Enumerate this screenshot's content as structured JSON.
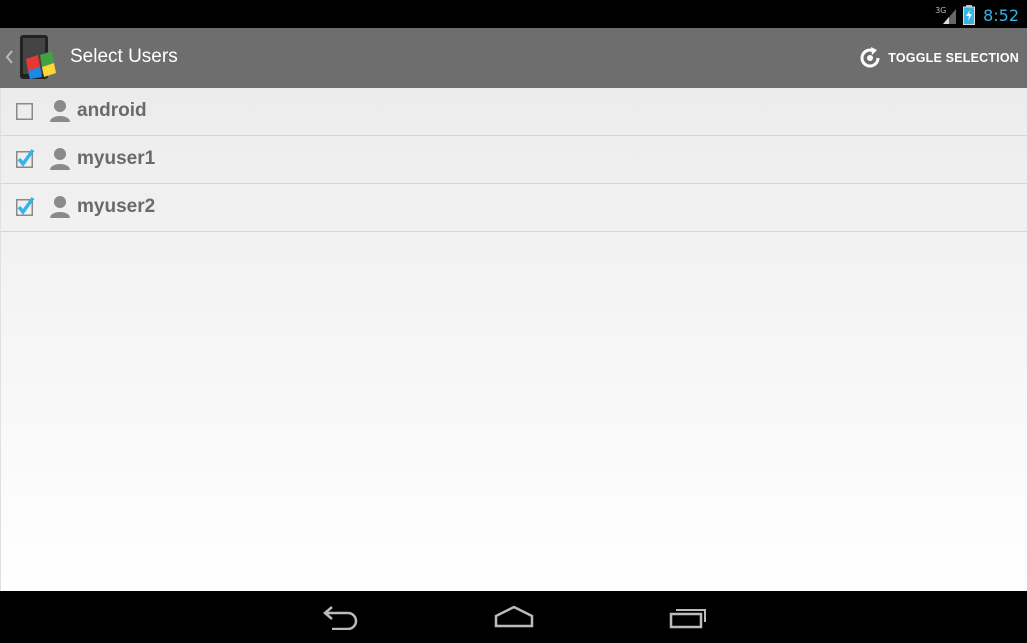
{
  "status_bar": {
    "network": "3G",
    "time": "8:52",
    "accent_color": "#33b5e5"
  },
  "action_bar": {
    "title": "Select Users",
    "toggle_label": "TOGGLE SELECTION",
    "background_color": "#6e6e6e"
  },
  "users": [
    {
      "name": "android",
      "checked": false
    },
    {
      "name": "myuser1",
      "checked": true
    },
    {
      "name": "myuser2",
      "checked": true
    }
  ],
  "icons": {
    "up": "up-caret-icon",
    "app": "app-logo-icon",
    "toggle": "refresh-icon",
    "user": "person-icon",
    "back": "back-icon",
    "home": "home-icon",
    "recents": "recent-apps-icon"
  }
}
